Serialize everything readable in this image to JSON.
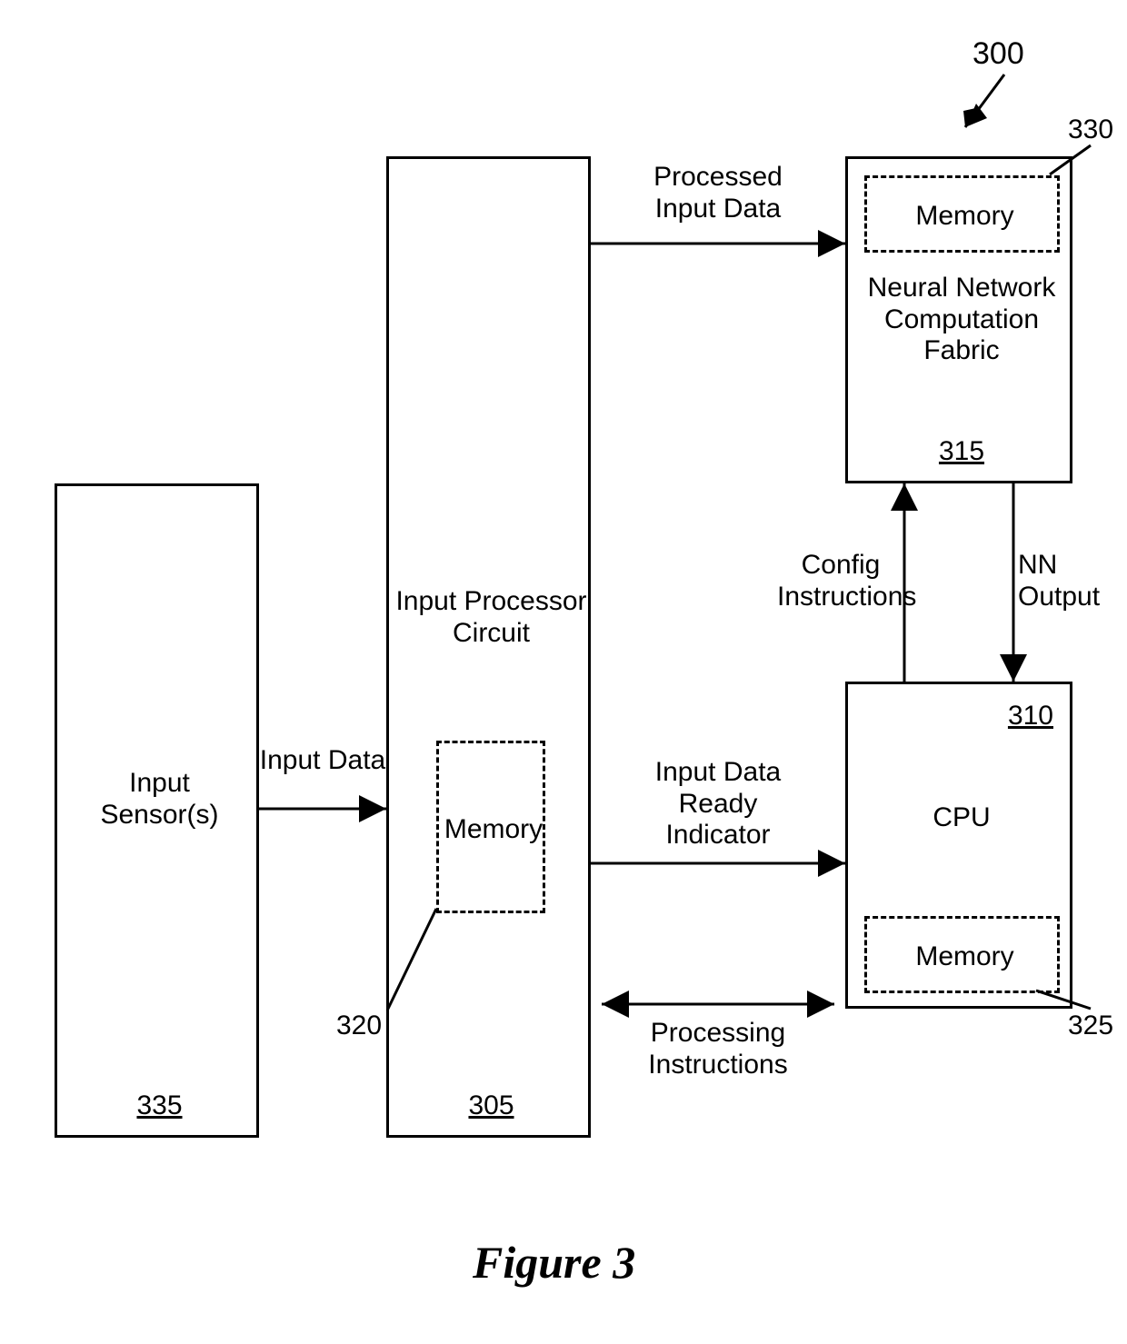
{
  "figure": {
    "number_label": "300",
    "caption": "Figure 3"
  },
  "blocks": {
    "input_sensors": {
      "title": "Input\nSensor(s)",
      "ref": "335"
    },
    "input_proc": {
      "title": "Input Processor\nCircuit",
      "ref": "305",
      "memory_label": "Memory",
      "memory_ref": "320"
    },
    "nn_fabric": {
      "title": "Neural Network\nComputation\nFabric",
      "ref": "315",
      "memory_label": "Memory",
      "memory_ref": "330"
    },
    "cpu": {
      "title": "CPU",
      "ref": "310",
      "memory_label": "Memory",
      "memory_ref": "325"
    }
  },
  "arrows": {
    "input_data": "Input Data",
    "processed_input": "Processed\nInput Data",
    "input_ready": "Input Data\nReady\nIndicator",
    "processing_instr": "Processing\nInstructions",
    "config_instr": "Config\nInstructions",
    "nn_output": "NN\nOutput"
  }
}
